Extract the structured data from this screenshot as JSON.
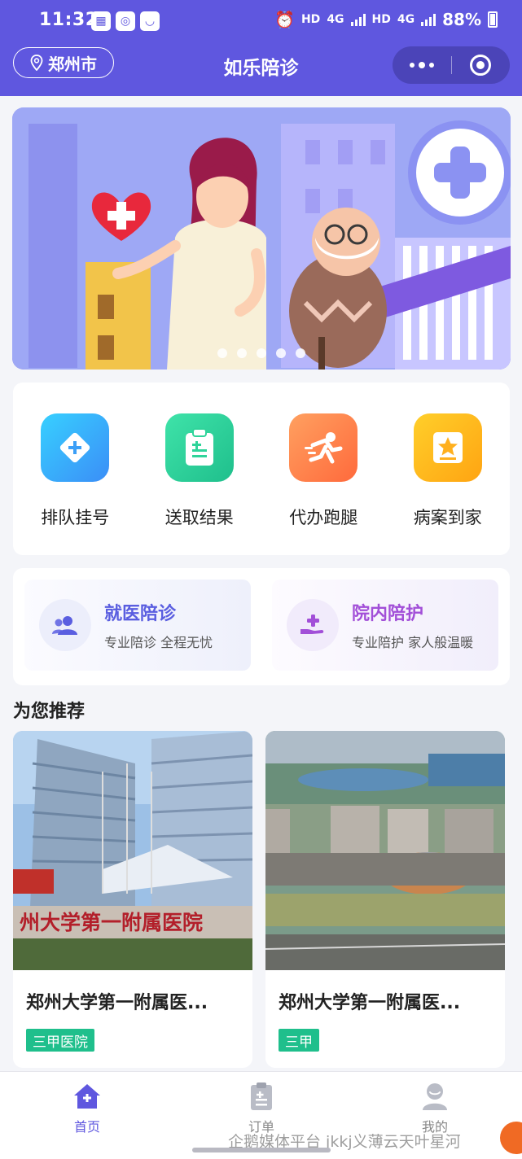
{
  "status_bar": {
    "time": "11:32",
    "left_icons": [
      "sim-icon",
      "sync-icon",
      "shield-icon"
    ],
    "hd1": "HD",
    "net1": "4G",
    "hd2": "HD",
    "net2": "4G",
    "battery": "88%"
  },
  "header": {
    "location": "郑州市",
    "title": "如乐陪诊",
    "accent": "#5f57df"
  },
  "banner": {
    "slides_total": 5,
    "active_slide": 1
  },
  "services": [
    {
      "label": "排队挂号",
      "icon": "plus-diamond-icon",
      "color": "#3bbcf5"
    },
    {
      "label": "送取结果",
      "icon": "clipboard-icon",
      "color": "#2fd49a"
    },
    {
      "label": "代办跑腿",
      "icon": "runner-icon",
      "color": "#ff7b4a"
    },
    {
      "label": "病案到家",
      "icon": "star-folder-icon",
      "color": "#ffb01e"
    }
  ],
  "features": [
    {
      "title": "就医陪诊",
      "subtitle": "专业陪诊 全程无忧",
      "icon": "people-icon",
      "color": "#5a5ee0"
    },
    {
      "title": "院内陪护",
      "subtitle": "专业陪护 家人般温暖",
      "icon": "care-hand-icon",
      "color": "#a24fd8"
    }
  ],
  "recommend": {
    "title": "为您推荐",
    "items": [
      {
        "name": "郑州大学第一附属医...",
        "badge": "三甲医院",
        "sign": "州大学第一附属医院"
      },
      {
        "name": "郑州大学第一附属医...",
        "badge": "三甲"
      }
    ]
  },
  "tabbar": [
    {
      "label": "首页",
      "icon": "home-icon",
      "active": true
    },
    {
      "label": "订单",
      "icon": "order-clipboard-icon",
      "active": false
    },
    {
      "label": "我的",
      "icon": "user-icon",
      "active": false
    }
  ],
  "watermark": "企鹅媒体平台 jkkj义薄云天叶星河"
}
